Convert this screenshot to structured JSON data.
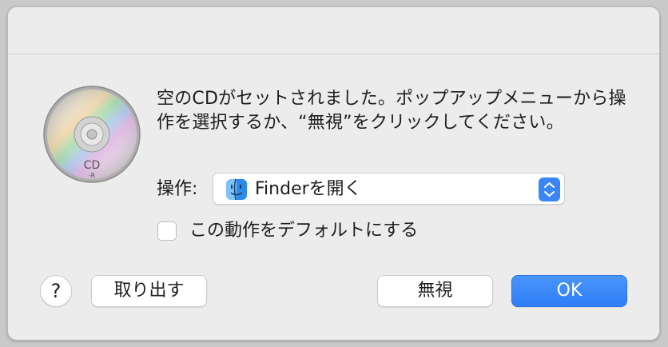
{
  "dialog": {
    "message": "空のCDがセットされました。ポップアップメニューから操作を選択するか、“無視”をクリックしてください。",
    "disc_label": "CD",
    "disc_sublabel": "-R",
    "action_label": "操作:",
    "action_value": "Finderを開く",
    "action_icon": "finder-icon",
    "checkbox_label": "この動作をデフォルトにする",
    "checkbox_checked": false,
    "help_label": "?",
    "eject_label": "取り出す",
    "ignore_label": "無視",
    "ok_label": "OK",
    "accent_color": "#3a86f5"
  }
}
